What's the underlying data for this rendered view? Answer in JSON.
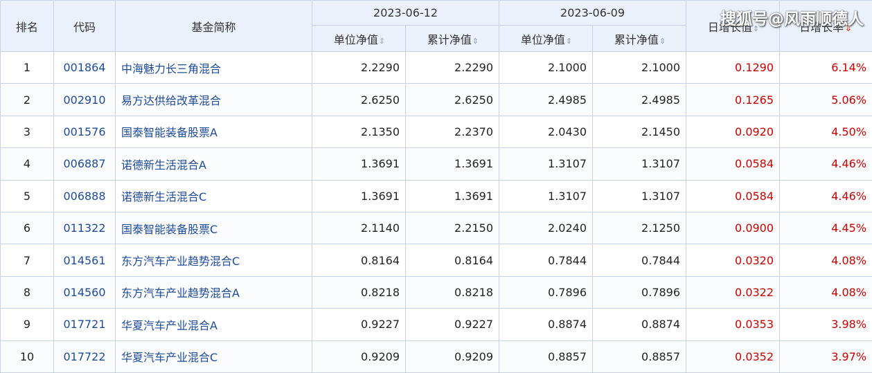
{
  "header": {
    "rank": "排名",
    "code": "代码",
    "name": "基金简称",
    "date1": "2023-06-12",
    "date2": "2023-06-09",
    "unit_nav": "单位净值",
    "acc_nav": "累计净值",
    "daily_growth_value": "日增长值",
    "daily_growth_rate": "日增长率",
    "sort_icon": "⇕",
    "sort_active_icon": "⇓"
  },
  "watermark": "搜狐号@风雨顺德人",
  "rows": [
    {
      "rank": "1",
      "code": "001864",
      "name": "中海魅力长三角混合",
      "nav1": "2.2290",
      "acc1": "2.2290",
      "nav2": "2.1000",
      "acc2": "2.1000",
      "growth": "0.1290",
      "rate": "6.14%"
    },
    {
      "rank": "2",
      "code": "002910",
      "name": "易方达供给改革混合",
      "nav1": "2.6250",
      "acc1": "2.6250",
      "nav2": "2.4985",
      "acc2": "2.4985",
      "growth": "0.1265",
      "rate": "5.06%"
    },
    {
      "rank": "3",
      "code": "001576",
      "name": "国泰智能装备股票A",
      "nav1": "2.1350",
      "acc1": "2.2370",
      "nav2": "2.0430",
      "acc2": "2.1450",
      "growth": "0.0920",
      "rate": "4.50%"
    },
    {
      "rank": "4",
      "code": "006887",
      "name": "诺德新生活混合A",
      "nav1": "1.3691",
      "acc1": "1.3691",
      "nav2": "1.3107",
      "acc2": "1.3107",
      "growth": "0.0584",
      "rate": "4.46%"
    },
    {
      "rank": "5",
      "code": "006888",
      "name": "诺德新生活混合C",
      "nav1": "1.3691",
      "acc1": "1.3691",
      "nav2": "1.3107",
      "acc2": "1.3107",
      "growth": "0.0584",
      "rate": "4.46%"
    },
    {
      "rank": "6",
      "code": "011322",
      "name": "国泰智能装备股票C",
      "nav1": "2.1140",
      "acc1": "2.2150",
      "nav2": "2.0240",
      "acc2": "2.1250",
      "growth": "0.0900",
      "rate": "4.45%"
    },
    {
      "rank": "7",
      "code": "014561",
      "name": "东方汽车产业趋势混合C",
      "nav1": "0.8164",
      "acc1": "0.8164",
      "nav2": "0.7844",
      "acc2": "0.7844",
      "growth": "0.0320",
      "rate": "4.08%"
    },
    {
      "rank": "8",
      "code": "014560",
      "name": "东方汽车产业趋势混合A",
      "nav1": "0.8218",
      "acc1": "0.8218",
      "nav2": "0.7896",
      "acc2": "0.7896",
      "growth": "0.0322",
      "rate": "4.08%"
    },
    {
      "rank": "9",
      "code": "017721",
      "name": "华夏汽车产业混合A",
      "nav1": "0.9227",
      "acc1": "0.9227",
      "nav2": "0.8874",
      "acc2": "0.8874",
      "growth": "0.0353",
      "rate": "3.98%"
    },
    {
      "rank": "10",
      "code": "017722",
      "name": "华夏汽车产业混合C",
      "nav1": "0.9209",
      "acc1": "0.9209",
      "nav2": "0.8857",
      "acc2": "0.8857",
      "growth": "0.0352",
      "rate": "3.97%"
    }
  ]
}
